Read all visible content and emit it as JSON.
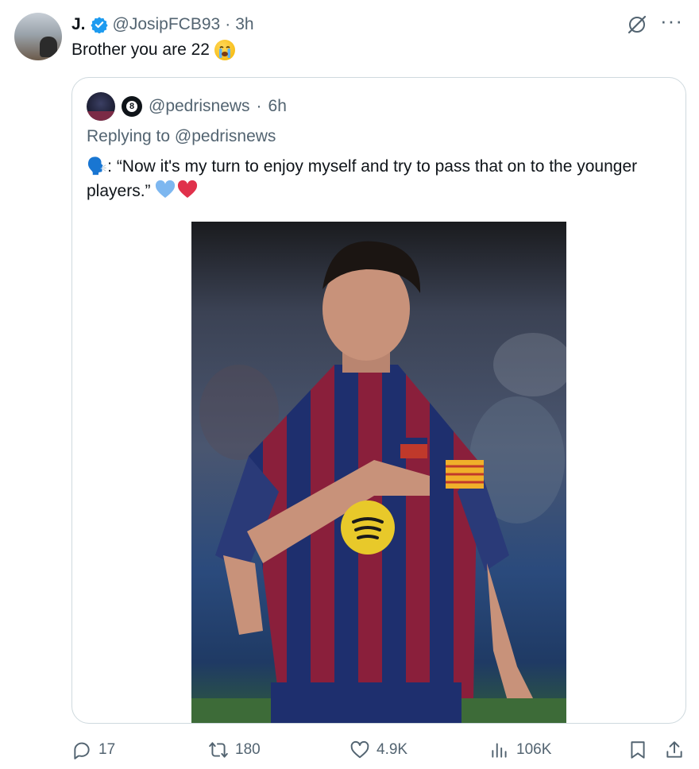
{
  "author": {
    "name": "J.",
    "handle": "@JosipFCB93",
    "time": "3h",
    "text": "Brother you are 22"
  },
  "quote": {
    "handle": "@pedrisnews",
    "time": "6h",
    "badge_number": "8",
    "replying_to": "Replying to @pedrisnews",
    "text": "🗣️: “Now it's my turn to enjoy myself and try to pass that on to the younger players.”"
  },
  "actions": {
    "replies": "17",
    "reposts": "180",
    "likes": "4.9K",
    "views": "106K"
  },
  "icons": [
    "verified-icon",
    "grok-icon",
    "more-icon",
    "reply-icon",
    "repost-icon",
    "like-icon",
    "views-icon",
    "bookmark-icon",
    "share-icon"
  ],
  "colors": {
    "verified": "#1d9bf0",
    "muted": "#536471",
    "border": "#cfd9de"
  }
}
